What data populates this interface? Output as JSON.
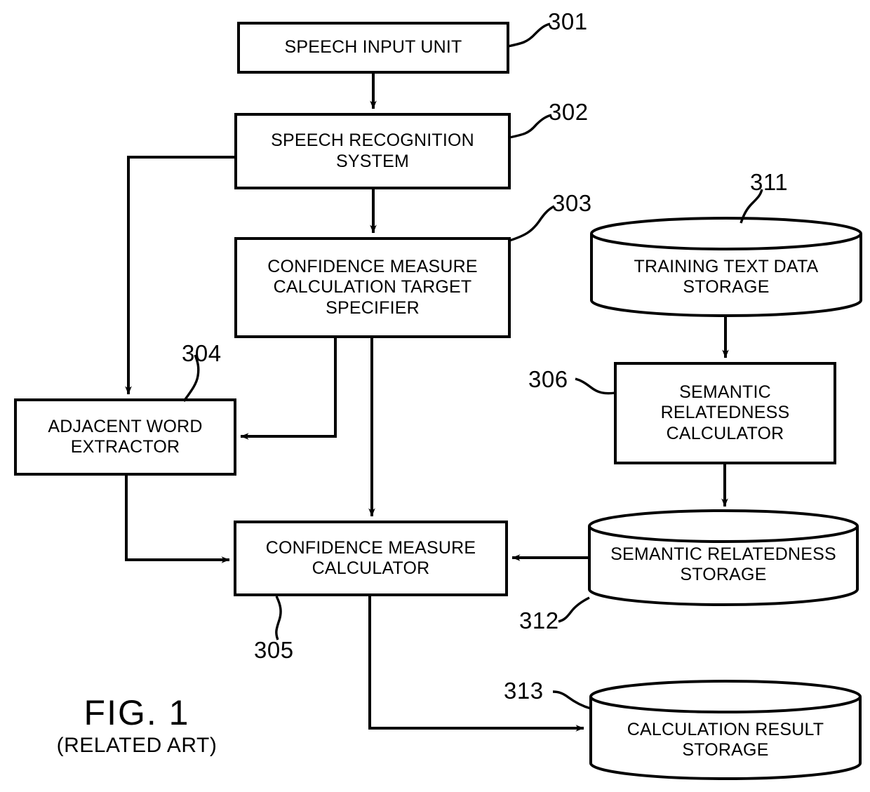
{
  "figure": {
    "caption_main": "FIG. 1",
    "caption_sub": "(RELATED ART)",
    "stroke_color": "#000000",
    "background_color": "#ffffff"
  },
  "nodes": {
    "speech_input_unit": {
      "label": "SPEECH INPUT UNIT",
      "ref": "301",
      "shape": "rect"
    },
    "speech_recognition_system": {
      "label": "SPEECH RECOGNITION\nSYSTEM",
      "ref": "302",
      "shape": "rect"
    },
    "confidence_measure_calculation_target_specifier": {
      "label": "CONFIDENCE MEASURE\nCALCULATION TARGET\nSPECIFIER",
      "ref": "303",
      "shape": "rect"
    },
    "adjacent_word_extractor": {
      "label": "ADJACENT WORD\nEXTRACTOR",
      "ref": "304",
      "shape": "rect"
    },
    "confidence_measure_calculator": {
      "label": "CONFIDENCE MEASURE\nCALCULATOR",
      "ref": "305",
      "shape": "rect"
    },
    "semantic_relatedness_calculator": {
      "label": "SEMANTIC\nRELATEDNESS\nCALCULATOR",
      "ref": "306",
      "shape": "rect"
    },
    "training_text_data_storage": {
      "label": "TRAINING TEXT DATA\nSTORAGE",
      "ref": "311",
      "shape": "cylinder"
    },
    "semantic_relatedness_storage": {
      "label": "SEMANTIC RELATEDNESS\nSTORAGE",
      "ref": "312",
      "shape": "cylinder"
    },
    "calculation_result_storage": {
      "label": "CALCULATION RESULT\nSTORAGE",
      "ref": "313",
      "shape": "cylinder"
    }
  },
  "connections": [
    {
      "name": "speech-input-to-recognition",
      "from": "speech_input_unit",
      "to": "speech_recognition_system"
    },
    {
      "name": "recognition-to-target-specifier",
      "from": "speech_recognition_system",
      "to": "confidence_measure_calculation_target_specifier"
    },
    {
      "name": "recognition-to-adjacent-word-extractor",
      "from": "speech_recognition_system",
      "to": "adjacent_word_extractor"
    },
    {
      "name": "target-specifier-to-adjacent-word-extractor",
      "from": "confidence_measure_calculation_target_specifier",
      "to": "adjacent_word_extractor"
    },
    {
      "name": "target-specifier-to-confidence-calculator",
      "from": "confidence_measure_calculation_target_specifier",
      "to": "confidence_measure_calculator"
    },
    {
      "name": "adjacent-word-extractor-to-confidence-calculator",
      "from": "adjacent_word_extractor",
      "to": "confidence_measure_calculator"
    },
    {
      "name": "training-text-to-semantic-calculator",
      "from": "training_text_data_storage",
      "to": "semantic_relatedness_calculator"
    },
    {
      "name": "semantic-calculator-to-semantic-storage",
      "from": "semantic_relatedness_calculator",
      "to": "semantic_relatedness_storage"
    },
    {
      "name": "semantic-storage-to-confidence-calculator",
      "from": "semantic_relatedness_storage",
      "to": "confidence_measure_calculator"
    },
    {
      "name": "confidence-calculator-to-result-storage",
      "from": "confidence_measure_calculator",
      "to": "calculation_result_storage"
    }
  ]
}
